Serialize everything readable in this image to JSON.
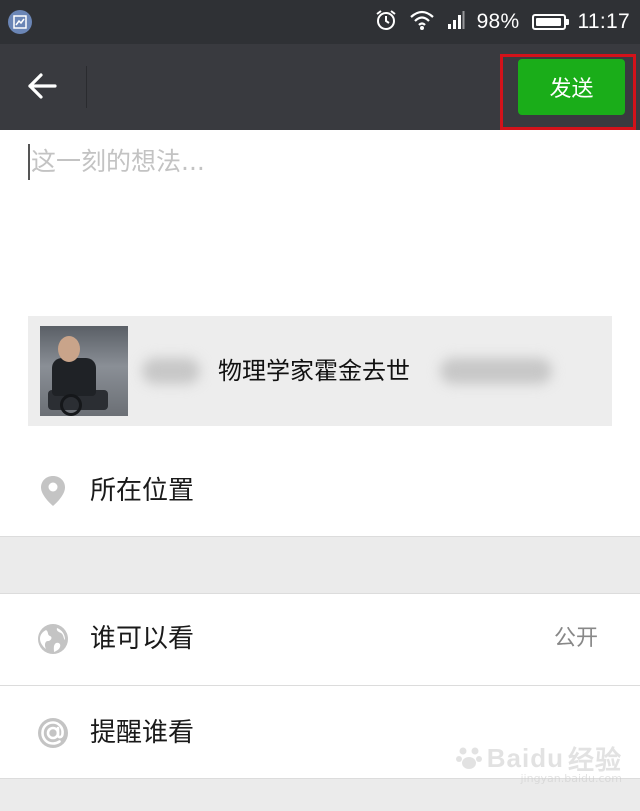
{
  "status_bar": {
    "battery": "98%",
    "battery_level": 0.98,
    "time": "11:17",
    "icons": [
      "app-notification-icon",
      "alarm-icon",
      "wifi-icon",
      "signal-icon",
      "battery-icon"
    ]
  },
  "app_bar": {
    "back_icon": "arrow-left-icon",
    "send_label": "发送"
  },
  "compose": {
    "placeholder": "这一刻的想法..."
  },
  "shared_link": {
    "title": "物理学家霍金去世"
  },
  "options": {
    "location": {
      "icon": "location-pin-icon",
      "label": "所在位置"
    },
    "visibility": {
      "icon": "globe-icon",
      "label": "谁可以看",
      "value": "公开"
    },
    "mention": {
      "icon": "at-icon",
      "label": "提醒谁看"
    }
  },
  "watermark": {
    "brand": "Baidu",
    "suffix": "经验",
    "url": "jingyan.baidu.com"
  },
  "colors": {
    "status_bar": "#2f3135",
    "app_bar": "#393a3f",
    "send_button": "#1aad19",
    "highlight_box": "#d3121a",
    "section_gap": "#ebebeb",
    "link_card": "#ededed"
  }
}
